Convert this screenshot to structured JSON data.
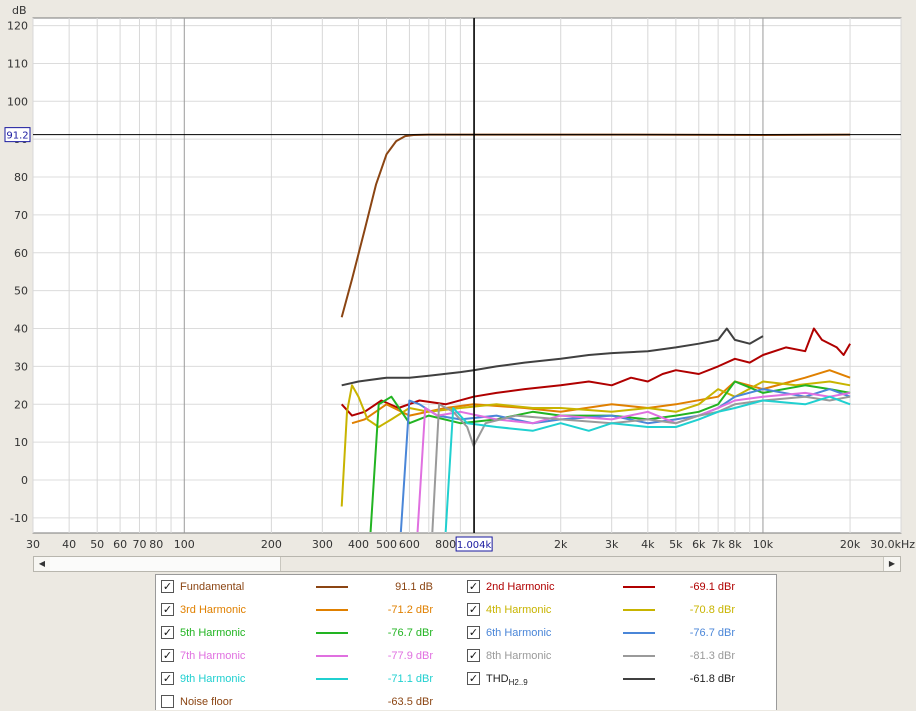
{
  "chart_data": {
    "type": "line",
    "ylabel": "dB",
    "xlabel": "",
    "x_unit_label": "30.0kHz",
    "x_scale": "log",
    "xlim": [
      30,
      30000
    ],
    "ylim": [
      -14,
      122
    ],
    "y_ticks": [
      "-10",
      "0",
      "10",
      "20",
      "30",
      "40",
      "50",
      "60",
      "70",
      "80",
      "90",
      "100",
      "110",
      "120"
    ],
    "x_ticks": [
      {
        "v": 30,
        "label": "30"
      },
      {
        "v": 40,
        "label": "40"
      },
      {
        "v": 50,
        "label": "50"
      },
      {
        "v": 60,
        "label": "60"
      },
      {
        "v": 70,
        "label": "70"
      },
      {
        "v": 80,
        "label": "80"
      },
      {
        "v": 100,
        "label": "100"
      },
      {
        "v": 200,
        "label": "200"
      },
      {
        "v": 300,
        "label": "300"
      },
      {
        "v": 400,
        "label": "400"
      },
      {
        "v": 500,
        "label": "500"
      },
      {
        "v": 600,
        "label": "600"
      },
      {
        "v": 800,
        "label": "800"
      },
      {
        "v": 2000,
        "label": "2k"
      },
      {
        "v": 3000,
        "label": "3k"
      },
      {
        "v": 4000,
        "label": "4k"
      },
      {
        "v": 5000,
        "label": "5k"
      },
      {
        "v": 6000,
        "label": "6k"
      },
      {
        "v": 7000,
        "label": "7k"
      },
      {
        "v": 8000,
        "label": "8k"
      },
      {
        "v": 10000,
        "label": "10k"
      },
      {
        "v": 20000,
        "label": "20k"
      }
    ],
    "cursor": {
      "x": 1004,
      "x_label": "1.004k",
      "y": 91.2,
      "y_label": "91.2"
    },
    "grid": true,
    "series": [
      {
        "name": "Fundamental",
        "color": "#8b4513",
        "points": [
          [
            350,
            43
          ],
          [
            380,
            53
          ],
          [
            420,
            66
          ],
          [
            460,
            78
          ],
          [
            500,
            86
          ],
          [
            540,
            89.5
          ],
          [
            580,
            90.8
          ],
          [
            620,
            91.1
          ],
          [
            700,
            91.2
          ],
          [
            1000,
            91.2
          ],
          [
            3000,
            91.2
          ],
          [
            10000,
            91.1
          ],
          [
            20000,
            91.2
          ]
        ]
      },
      {
        "name": "2nd Harmonic",
        "color": "#b00000",
        "points": [
          [
            350,
            20
          ],
          [
            380,
            17
          ],
          [
            420,
            18
          ],
          [
            480,
            21
          ],
          [
            550,
            19
          ],
          [
            650,
            21
          ],
          [
            800,
            20
          ],
          [
            1000,
            22
          ],
          [
            1200,
            23
          ],
          [
            1500,
            24
          ],
          [
            2000,
            25
          ],
          [
            2500,
            26
          ],
          [
            3000,
            25
          ],
          [
            3500,
            27
          ],
          [
            4000,
            26
          ],
          [
            4500,
            28
          ],
          [
            5000,
            29
          ],
          [
            6000,
            28
          ],
          [
            7000,
            30
          ],
          [
            8000,
            32
          ],
          [
            9000,
            31
          ],
          [
            10000,
            33
          ],
          [
            12000,
            35
          ],
          [
            14000,
            34
          ],
          [
            15000,
            40
          ],
          [
            16000,
            37
          ],
          [
            18000,
            35
          ],
          [
            19000,
            33
          ],
          [
            20000,
            36
          ]
        ]
      },
      {
        "name": "3rd Harmonic",
        "color": "#e08000",
        "points": [
          [
            380,
            15
          ],
          [
            420,
            16
          ],
          [
            500,
            20
          ],
          [
            600,
            17
          ],
          [
            800,
            19
          ],
          [
            1000,
            20
          ],
          [
            1500,
            19
          ],
          [
            2000,
            18
          ],
          [
            3000,
            20
          ],
          [
            4000,
            19
          ],
          [
            5000,
            20
          ],
          [
            7000,
            22
          ],
          [
            8000,
            26
          ],
          [
            10000,
            24
          ],
          [
            14000,
            27
          ],
          [
            17000,
            29
          ],
          [
            20000,
            27
          ]
        ]
      },
      {
        "name": "4th Harmonic",
        "color": "#c8b400",
        "points": [
          [
            350,
            -7
          ],
          [
            365,
            18
          ],
          [
            380,
            25
          ],
          [
            400,
            22
          ],
          [
            430,
            16
          ],
          [
            470,
            14
          ],
          [
            520,
            16
          ],
          [
            600,
            19
          ],
          [
            700,
            18
          ],
          [
            900,
            19
          ],
          [
            1200,
            20
          ],
          [
            1600,
            19
          ],
          [
            2000,
            19
          ],
          [
            3000,
            18
          ],
          [
            4000,
            19
          ],
          [
            5000,
            18
          ],
          [
            6000,
            20
          ],
          [
            7000,
            24
          ],
          [
            8000,
            22
          ],
          [
            10000,
            26
          ],
          [
            13000,
            25
          ],
          [
            17000,
            26
          ],
          [
            20000,
            25
          ]
        ]
      },
      {
        "name": "5th Harmonic",
        "color": "#22b422",
        "points": [
          [
            440,
            -14
          ],
          [
            470,
            20
          ],
          [
            520,
            22
          ],
          [
            600,
            15
          ],
          [
            700,
            17
          ],
          [
            900,
            15
          ],
          [
            1200,
            16
          ],
          [
            1600,
            18
          ],
          [
            2000,
            17
          ],
          [
            3000,
            17
          ],
          [
            4000,
            16
          ],
          [
            5000,
            17
          ],
          [
            6000,
            18
          ],
          [
            7000,
            20
          ],
          [
            8000,
            26
          ],
          [
            10000,
            23
          ],
          [
            14000,
            25
          ],
          [
            17000,
            24
          ],
          [
            20000,
            23
          ]
        ]
      },
      {
        "name": "6th Harmonic",
        "color": "#4a86d8",
        "points": [
          [
            560,
            -14
          ],
          [
            600,
            21
          ],
          [
            650,
            20
          ],
          [
            750,
            17
          ],
          [
            900,
            16
          ],
          [
            1200,
            17
          ],
          [
            1600,
            15
          ],
          [
            2000,
            16
          ],
          [
            3000,
            17
          ],
          [
            4000,
            15
          ],
          [
            5000,
            16
          ],
          [
            6000,
            17
          ],
          [
            7000,
            19
          ],
          [
            8000,
            22
          ],
          [
            10000,
            24
          ],
          [
            14000,
            22
          ],
          [
            17000,
            24
          ],
          [
            20000,
            22
          ]
        ]
      },
      {
        "name": "7th Harmonic",
        "color": "#e070e0",
        "points": [
          [
            640,
            -14
          ],
          [
            680,
            19
          ],
          [
            750,
            17
          ],
          [
            900,
            18
          ],
          [
            1200,
            16
          ],
          [
            1600,
            15
          ],
          [
            2000,
            17
          ],
          [
            3000,
            16
          ],
          [
            4000,
            18
          ],
          [
            5000,
            15
          ],
          [
            6000,
            17
          ],
          [
            7000,
            19
          ],
          [
            8000,
            21
          ],
          [
            10000,
            22
          ],
          [
            14000,
            23
          ],
          [
            17000,
            22
          ],
          [
            20000,
            23
          ]
        ]
      },
      {
        "name": "8th Harmonic",
        "color": "#9a9a9a",
        "points": [
          [
            720,
            -14
          ],
          [
            760,
            20
          ],
          [
            850,
            18
          ],
          [
            950,
            14
          ],
          [
            1000,
            9
          ],
          [
            1100,
            15
          ],
          [
            1400,
            17
          ],
          [
            2000,
            16
          ],
          [
            3000,
            15
          ],
          [
            4000,
            16
          ],
          [
            5000,
            15
          ],
          [
            6000,
            17
          ],
          [
            7000,
            18
          ],
          [
            8000,
            20
          ],
          [
            10000,
            21
          ],
          [
            14000,
            22
          ],
          [
            17000,
            21
          ],
          [
            20000,
            22
          ]
        ]
      },
      {
        "name": "9th Harmonic",
        "color": "#20d0d0",
        "points": [
          [
            800,
            -14
          ],
          [
            850,
            19
          ],
          [
            950,
            15
          ],
          [
            1200,
            14
          ],
          [
            1600,
            13
          ],
          [
            2000,
            15
          ],
          [
            2500,
            13
          ],
          [
            3000,
            15
          ],
          [
            4000,
            14
          ],
          [
            5000,
            14
          ],
          [
            6000,
            16
          ],
          [
            7000,
            18
          ],
          [
            8000,
            19
          ],
          [
            10000,
            21
          ],
          [
            14000,
            20
          ],
          [
            17000,
            22
          ],
          [
            20000,
            20
          ]
        ]
      },
      {
        "name": "THD",
        "color": "#404040",
        "points": [
          [
            350,
            25
          ],
          [
            400,
            26
          ],
          [
            500,
            27
          ],
          [
            600,
            27
          ],
          [
            700,
            27.5
          ],
          [
            900,
            28.5
          ],
          [
            1000,
            29
          ],
          [
            1200,
            30
          ],
          [
            1500,
            31
          ],
          [
            2000,
            32
          ],
          [
            2500,
            33
          ],
          [
            3000,
            33.5
          ],
          [
            4000,
            34
          ],
          [
            5000,
            35
          ],
          [
            6000,
            36
          ],
          [
            7000,
            37
          ],
          [
            7500,
            40
          ],
          [
            8000,
            37
          ],
          [
            9000,
            36
          ],
          [
            10000,
            38
          ]
        ]
      }
    ]
  },
  "legend": {
    "items": [
      {
        "name": "Fundamental",
        "value": "91.1 dB",
        "color": "#8b4513",
        "checked": "✓"
      },
      {
        "name": "2nd Harmonic",
        "value": "-69.1 dBr",
        "color": "#b00000",
        "checked": "✓"
      },
      {
        "name": "3rd Harmonic",
        "value": "-71.2 dBr",
        "color": "#e08000",
        "checked": "✓"
      },
      {
        "name": "4th Harmonic",
        "value": "-70.8 dBr",
        "color": "#c8b400",
        "checked": "✓"
      },
      {
        "name": "5th Harmonic",
        "value": "-76.7 dBr",
        "color": "#22b422",
        "checked": "✓"
      },
      {
        "name": "6th Harmonic",
        "value": "-76.7 dBr",
        "color": "#4a86d8",
        "checked": "✓"
      },
      {
        "name": "7th Harmonic",
        "value": "-77.9 dBr",
        "color": "#e070e0",
        "checked": "✓"
      },
      {
        "name": "8th Harmonic",
        "value": "-81.3 dBr",
        "color": "#9a9a9a",
        "checked": "✓"
      },
      {
        "name": "9th Harmonic",
        "value": "-71.1 dBr",
        "color": "#20d0d0",
        "checked": "✓"
      },
      {
        "name": "THD",
        "sub": "H2..9",
        "value": "-61.8 dBr",
        "color": "#404040",
        "checked": "✓"
      },
      {
        "name": "Noise floor",
        "value": "-63.5 dBr",
        "color": "#8b4513",
        "checked": ""
      }
    ]
  },
  "scrollbar": {
    "left_arrow": "◀",
    "right_arrow": "▶"
  }
}
